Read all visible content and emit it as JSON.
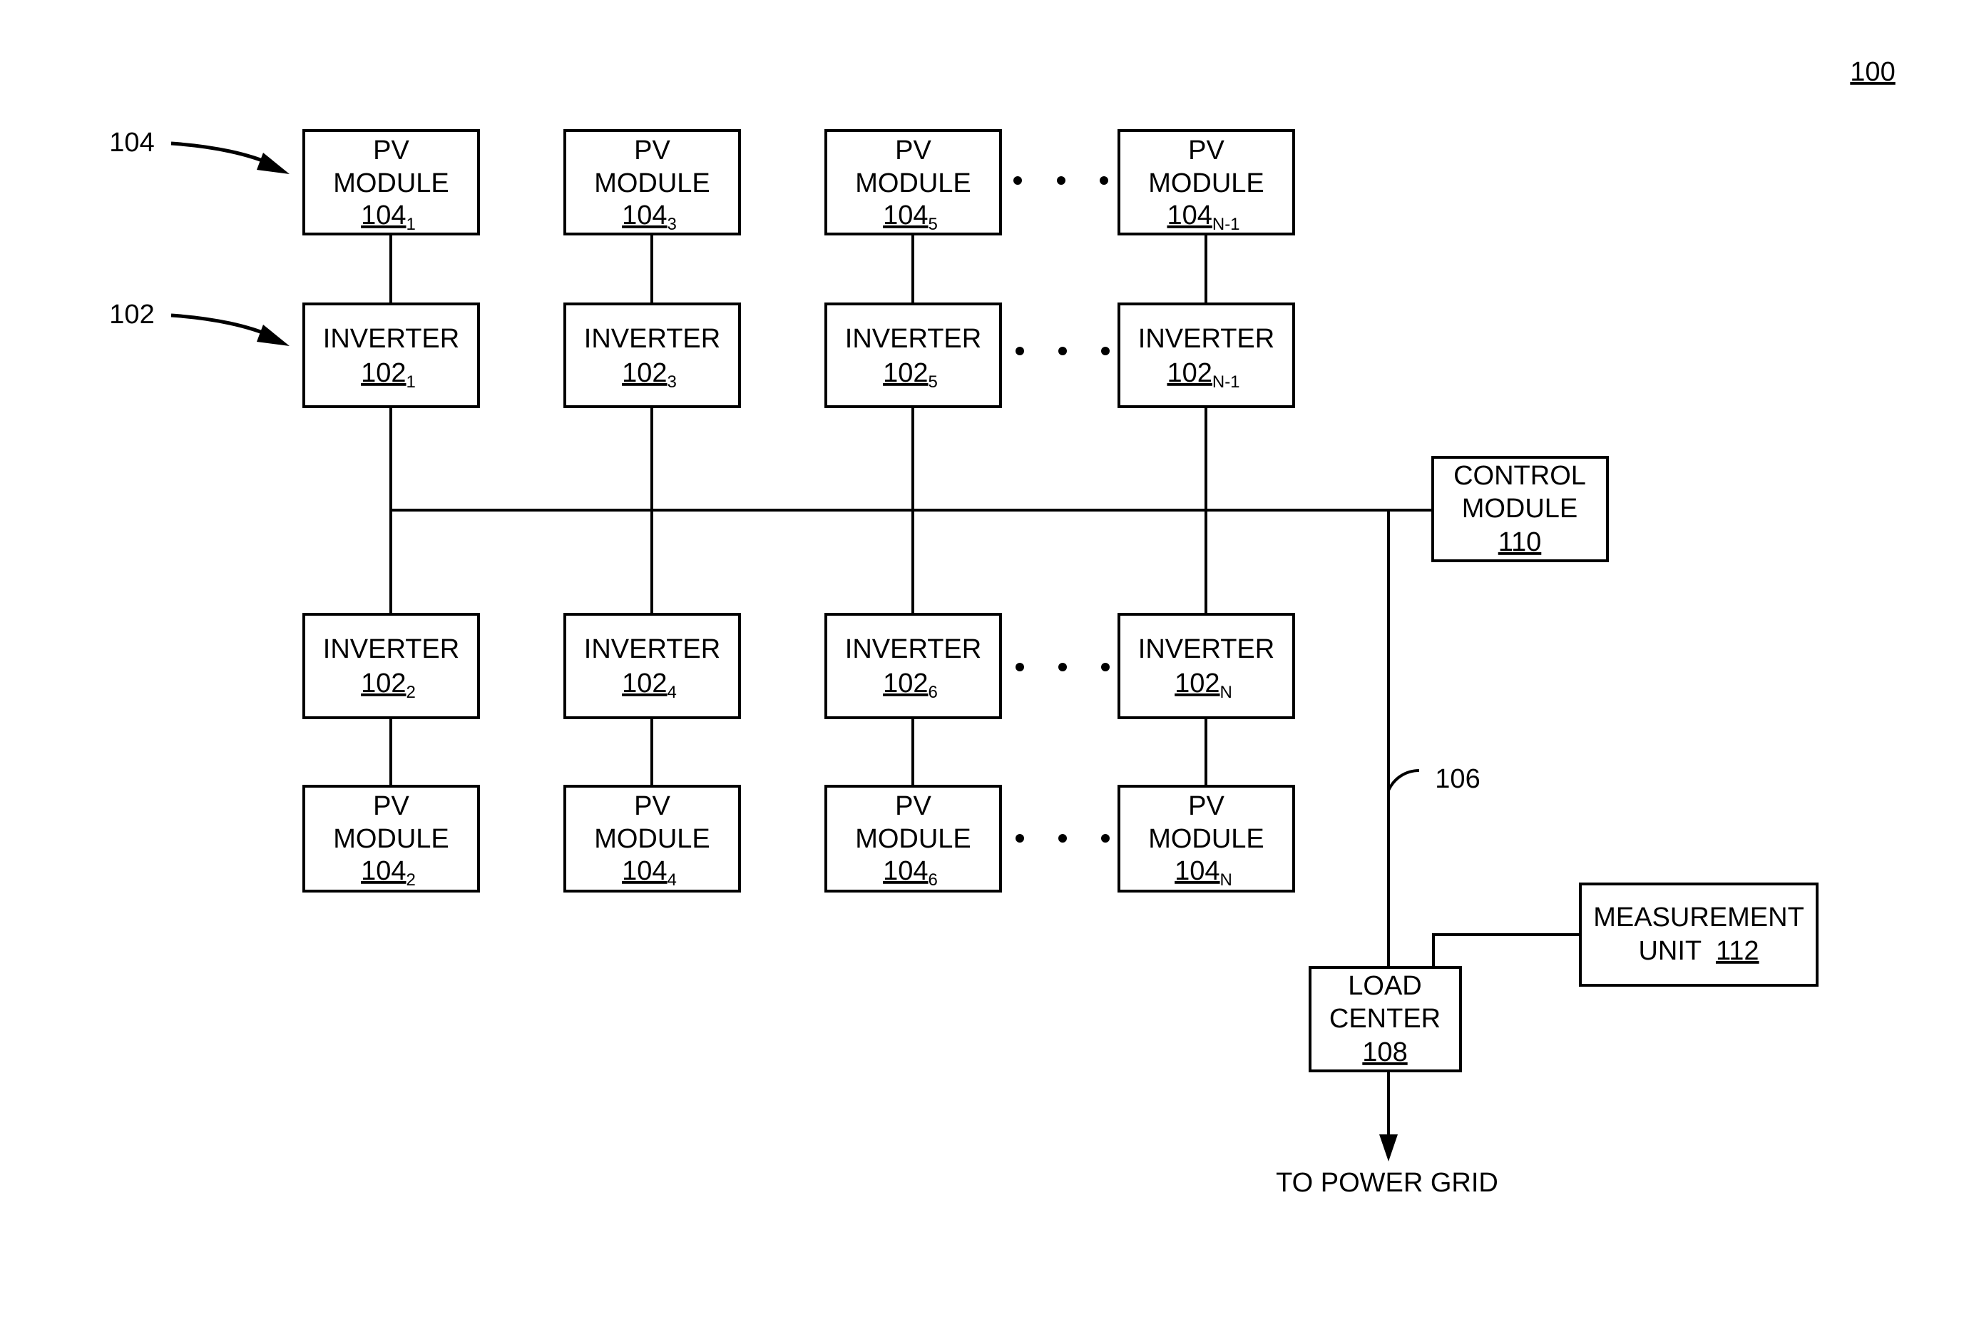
{
  "figure": {
    "reference": "100"
  },
  "callouts": {
    "pv_modules": "104",
    "inverters": "102",
    "bus_line": "106"
  },
  "columns": [
    {
      "pv_top": {
        "line1": "PV",
        "line2": "MODULE",
        "ref": "104",
        "sub": "1"
      },
      "inv_top": {
        "line1": "INVERTER",
        "ref": "102",
        "sub": "1"
      },
      "inv_bot": {
        "line1": "INVERTER",
        "ref": "102",
        "sub": "2"
      },
      "pv_bot": {
        "line1": "PV",
        "line2": "MODULE",
        "ref": "104",
        "sub": "2"
      }
    },
    {
      "pv_top": {
        "line1": "PV",
        "line2": "MODULE",
        "ref": "104",
        "sub": "3"
      },
      "inv_top": {
        "line1": "INVERTER",
        "ref": "102",
        "sub": "3"
      },
      "inv_bot": {
        "line1": "INVERTER",
        "ref": "102",
        "sub": "4"
      },
      "pv_bot": {
        "line1": "PV",
        "line2": "MODULE",
        "ref": "104",
        "sub": "4"
      }
    },
    {
      "pv_top": {
        "line1": "PV",
        "line2": "MODULE",
        "ref": "104",
        "sub": "5"
      },
      "inv_top": {
        "line1": "INVERTER",
        "ref": "102",
        "sub": "5"
      },
      "inv_bot": {
        "line1": "INVERTER",
        "ref": "102",
        "sub": "6"
      },
      "pv_bot": {
        "line1": "PV",
        "line2": "MODULE",
        "ref": "104",
        "sub": "6"
      }
    },
    {
      "pv_top": {
        "line1": "PV",
        "line2": "MODULE",
        "ref": "104",
        "sub": "N-1"
      },
      "inv_top": {
        "line1": "INVERTER",
        "ref": "102",
        "sub": "N-1"
      },
      "inv_bot": {
        "line1": "INVERTER",
        "ref": "102",
        "sub": "N"
      },
      "pv_bot": {
        "line1": "PV",
        "line2": "MODULE",
        "ref": "104",
        "sub": "N"
      }
    }
  ],
  "control_module": {
    "line1": "CONTROL",
    "line2": "MODULE",
    "ref": "110"
  },
  "load_center": {
    "line1": "LOAD",
    "line2": "CENTER",
    "ref": "108"
  },
  "measurement_unit": {
    "line1": "MEASUREMENT",
    "line2": "UNIT",
    "ref": "112"
  },
  "output_label": "TO POWER GRID",
  "ellipsis": "• • •"
}
